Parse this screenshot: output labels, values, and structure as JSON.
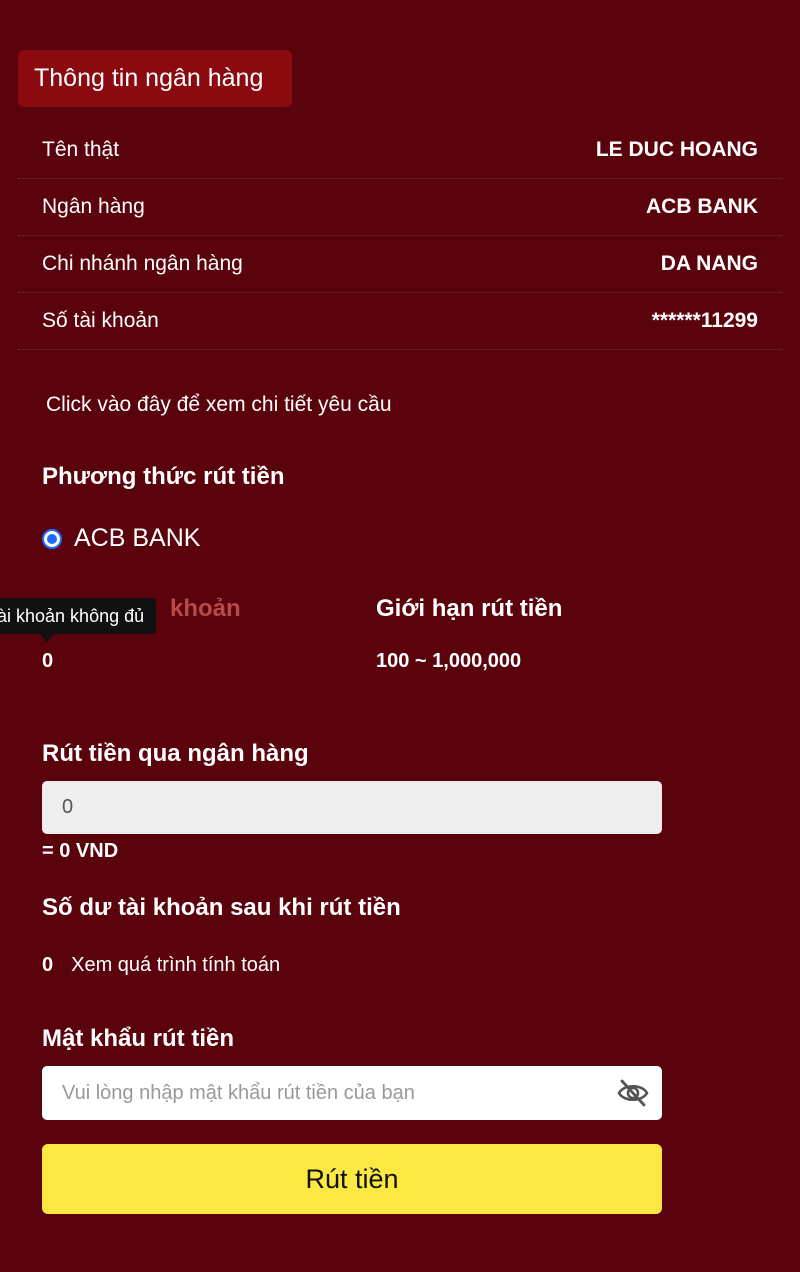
{
  "bank_info": {
    "title": "Thông tin ngân hàng",
    "rows": [
      {
        "label": "Tên thật",
        "value": "LE DUC HOANG"
      },
      {
        "label": "Ngân hàng",
        "value": "ACB BANK"
      },
      {
        "label": "Chi nhánh ngân hàng",
        "value": "DA NANG"
      },
      {
        "label": "Số tài khoản",
        "value": "******11299"
      }
    ]
  },
  "details_link": "Click vào đây để xem chi tiết yêu cầu",
  "withdraw_method": {
    "title": "Phương thức rút tiền",
    "option_label": "ACB BANK",
    "selected": true
  },
  "balance": {
    "label_visible": "khoản",
    "value": "0",
    "tooltip": "tài khoản không đủ"
  },
  "limit": {
    "label": "Giới hạn rút tiền",
    "value": "100 ~ 1,000,000"
  },
  "bank_withdraw": {
    "title": "Rút tiền qua ngân hàng",
    "amount_value": "0",
    "converted": "= 0 VND"
  },
  "after_withdraw": {
    "title": "Số dư tài khoản sau khi rút tiền",
    "value": "0",
    "calc_link": "Xem quá trình tính toán"
  },
  "password": {
    "title": "Mật khẩu rút tiền",
    "placeholder": "Vui lòng nhập mật khẩu rút tiền của bạn"
  },
  "submit_label": "Rút tiền",
  "colors": {
    "background": "#5a030d",
    "tag": "#8a0a10",
    "button": "#fbe843"
  }
}
